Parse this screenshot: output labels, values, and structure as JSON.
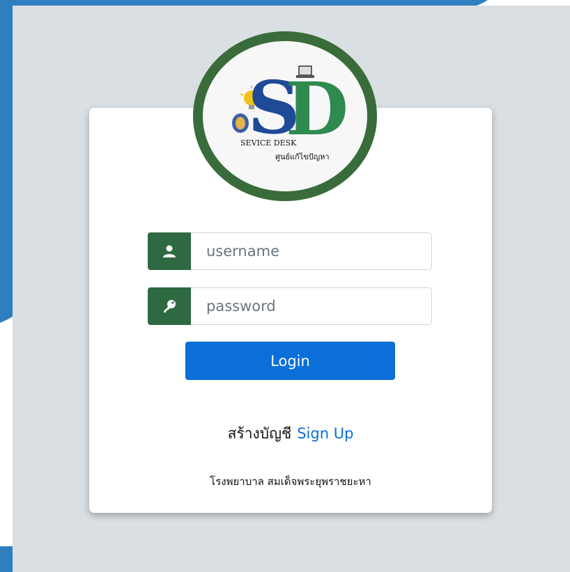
{
  "colors": {
    "page_blue": "#2f7fc0",
    "panel_gray": "#d9dfe2",
    "card_white": "#ffffff",
    "addon_green": "#2e6941",
    "button_blue": "#0a6fd8",
    "logo_ring_green": "#3a6b3a"
  },
  "logo": {
    "letters": "SD",
    "caption": "SEVICE DESK",
    "subcaption": "ศูนย์แก้ไขปัญหา"
  },
  "form": {
    "username": {
      "icon": "user-icon",
      "placeholder": "username",
      "value": ""
    },
    "password": {
      "icon": "key-icon",
      "placeholder": "password",
      "value": ""
    },
    "login_label": "Login"
  },
  "signup": {
    "prompt": "สร้างบัญชี",
    "link_label": "Sign Up"
  },
  "footer": {
    "organization": "โรงพยาบาล สมเด็จพระยุพราชยะหา"
  }
}
